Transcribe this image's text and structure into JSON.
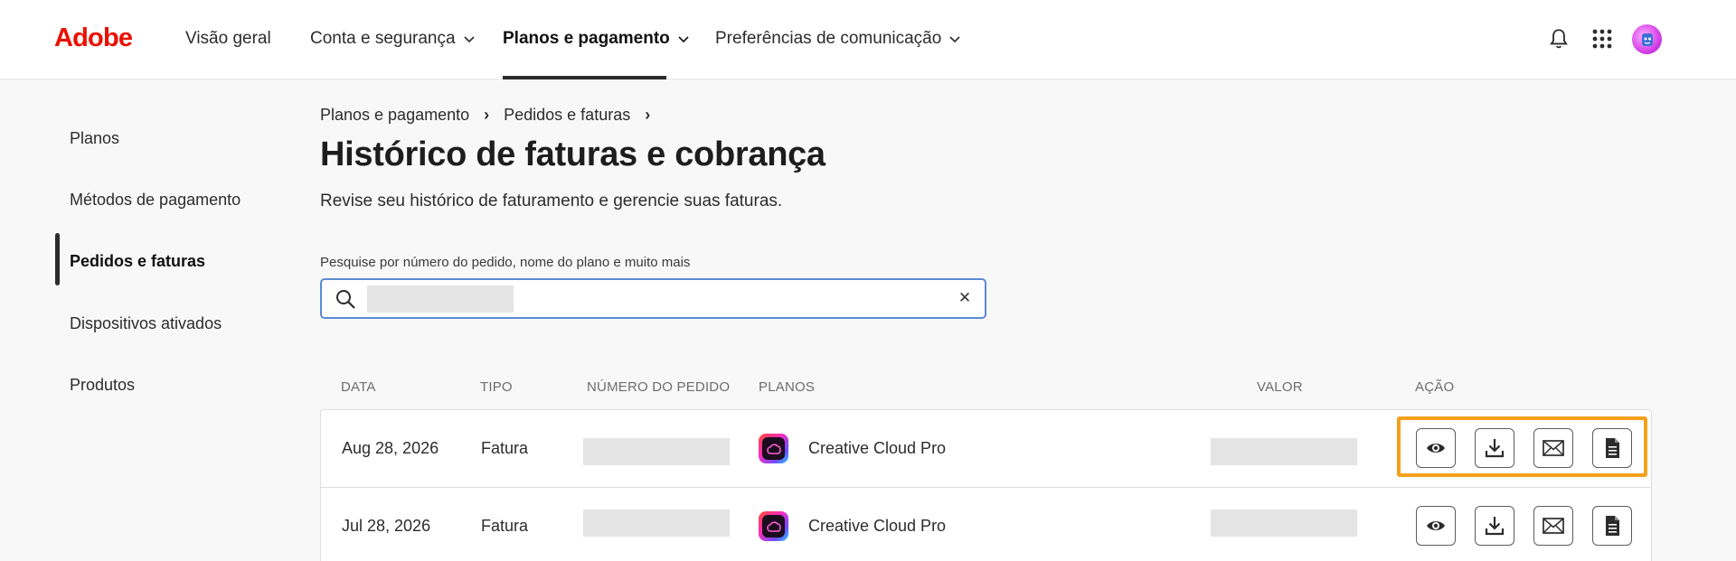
{
  "brand": {
    "logo_text": "Adobe",
    "color": "#eb1000"
  },
  "topnav": {
    "items": [
      {
        "label": "Visão geral",
        "has_dropdown": false,
        "active": false
      },
      {
        "label": "Conta e segurança",
        "has_dropdown": true,
        "active": false
      },
      {
        "label": "Planos e pagamento",
        "has_dropdown": true,
        "active": true
      },
      {
        "label": "Preferências de comunicação",
        "has_dropdown": true,
        "active": false
      }
    ],
    "icons": [
      "bell-icon",
      "apps-grid-icon",
      "avatar"
    ]
  },
  "sidebar": {
    "items": [
      {
        "label": "Planos",
        "active": false
      },
      {
        "label": "Métodos de pagamento",
        "active": false
      },
      {
        "label": "Pedidos e faturas",
        "active": true
      },
      {
        "label": "Dispositivos ativados",
        "active": false
      },
      {
        "label": "Produtos",
        "active": false
      }
    ]
  },
  "breadcrumb": [
    "Planos e pagamento",
    "Pedidos e faturas"
  ],
  "page": {
    "title": "Histórico de faturas e cobrança",
    "description": "Revise seu histórico de faturamento e gerencie suas faturas."
  },
  "search": {
    "label": "Pesquise por número do pedido, nome do plano e muito mais",
    "value": "",
    "clear_icon": "close-icon"
  },
  "table": {
    "headers": [
      "DATA",
      "TIPO",
      "NÚMERO DO PEDIDO",
      "PLANOS",
      "VALOR",
      "AÇÃO"
    ],
    "rows": [
      {
        "date": "Aug 28, 2026",
        "type": "Fatura",
        "plan": "Creative Cloud Pro"
      },
      {
        "date": "Jul 28, 2026",
        "type": "Fatura",
        "plan": "Creative Cloud Pro"
      }
    ],
    "actions": [
      "eye-icon",
      "download-icon",
      "email-icon",
      "document-icon"
    ]
  },
  "colors": {
    "highlight": "#f5a01a",
    "search_border": "#5b8ad6",
    "accent": "#eb1000"
  }
}
